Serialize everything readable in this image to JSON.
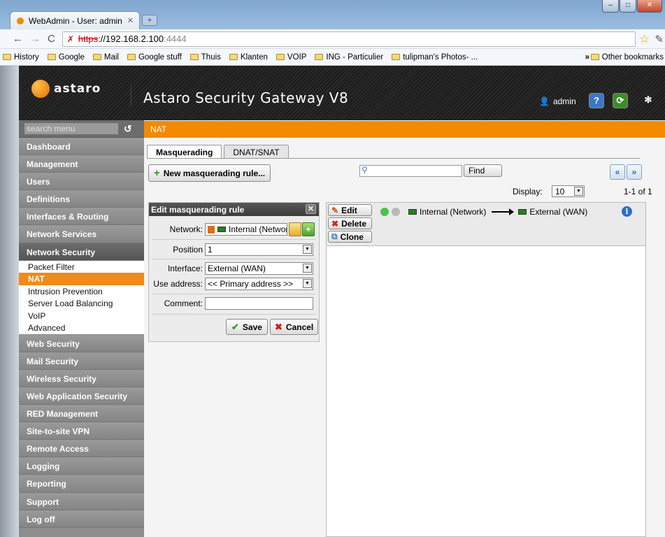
{
  "browser": {
    "tab_title": "WebAdmin - User: admin...",
    "url_scheme": "https",
    "url_host": "://192.168.2.100",
    "url_port": ":4444",
    "bookmarks": [
      "History",
      "Google",
      "Mail",
      "Google stuff",
      "Thuis",
      "Klanten",
      "VOIP",
      "ING - Particulier",
      "tulipman's Photos- ..."
    ],
    "bookmarks_more": "»",
    "other_bookmarks": "Other bookmarks"
  },
  "header": {
    "logo_text": "astaro",
    "product": "Astaro Security Gateway V8",
    "user": "admin"
  },
  "sidebar": {
    "search_placeholder": "search menu",
    "items_top": [
      "Dashboard",
      "Management",
      "Users",
      "Definitions",
      "Interfaces & Routing",
      "Network Services"
    ],
    "active_item": "Network Security",
    "sub_items": [
      "Packet Filter",
      "NAT",
      "Intrusion Prevention",
      "Server Load Balancing",
      "VoIP",
      "Advanced"
    ],
    "selected_sub": "NAT",
    "items_bottom": [
      "Web Security",
      "Mail Security",
      "Wireless Security",
      "Web Application Security",
      "RED Management",
      "Site-to-site VPN",
      "Remote Access",
      "Logging",
      "Reporting",
      "Support",
      "Log off"
    ]
  },
  "content": {
    "page_title": "NAT",
    "tabs": [
      "Masquerading",
      "DNAT/SNAT"
    ],
    "new_rule_label": "New masquerading rule...",
    "find_label": "Find",
    "display_label": "Display:",
    "display_value": "10",
    "count_label": "1-1 of 1"
  },
  "edit_panel": {
    "title": "Edit masquerading rule",
    "network_label": "Network:",
    "network_value": "Internal (Network)",
    "position_label": "Position",
    "position_value": "1",
    "interface_label": "Interface:",
    "interface_value": "External (WAN)",
    "use_address_label": "Use address:",
    "use_address_value": "<< Primary address >>",
    "comment_label": "Comment:",
    "comment_value": "",
    "save_label": "Save",
    "cancel_label": "Cancel"
  },
  "rule": {
    "edit_label": "Edit",
    "delete_label": "Delete",
    "clone_label": "Clone",
    "source": "Internal (Network)",
    "destination": "External (WAN)",
    "status_colors": [
      "#4cc24c",
      "#b9b9b9"
    ]
  }
}
